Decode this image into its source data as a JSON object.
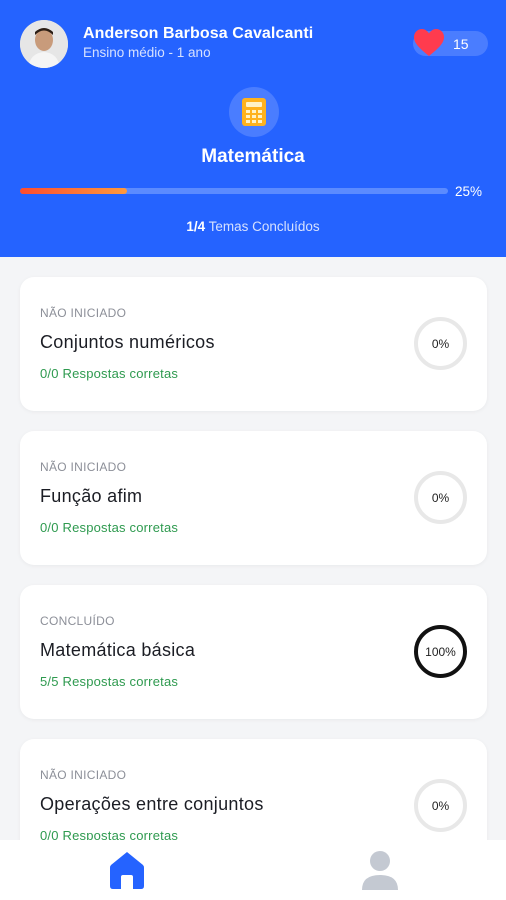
{
  "user": {
    "name": "Anderson Barbosa Cavalcanti",
    "grade": "Ensino médio - 1 ano",
    "lives": "15"
  },
  "subject": {
    "title": "Matemática",
    "progress_percent": 25,
    "progress_label": "25%",
    "completed": "1/4",
    "completed_suffix": "Temas Concluídos"
  },
  "topics": [
    {
      "status": "NÃO INICIADO",
      "title": "Conjuntos numéricos",
      "correct": "0/0 Respostas corretas",
      "percent": "0%",
      "done": false
    },
    {
      "status": "NÃO INICIADO",
      "title": "Função afim",
      "correct": "0/0 Respostas corretas",
      "percent": "0%",
      "done": false
    },
    {
      "status": "CONCLUÍDO",
      "title": "Matemática básica",
      "correct": "5/5 Respostas corretas",
      "percent": "100%",
      "done": true
    },
    {
      "status": "NÃO INICIADO",
      "title": "Operações entre conjuntos",
      "correct": "0/0 Respostas corretas",
      "percent": "0%",
      "done": false
    }
  ],
  "colors": {
    "header": "#2563ff",
    "correct": "#2e9a4f",
    "progress_start": "#ff4c2e",
    "progress_end": "#ff9a3d"
  },
  "icons": {
    "lives": "heart-icon",
    "subject": "calculator-icon",
    "nav_home": "home-icon",
    "nav_profile": "profile-icon"
  }
}
